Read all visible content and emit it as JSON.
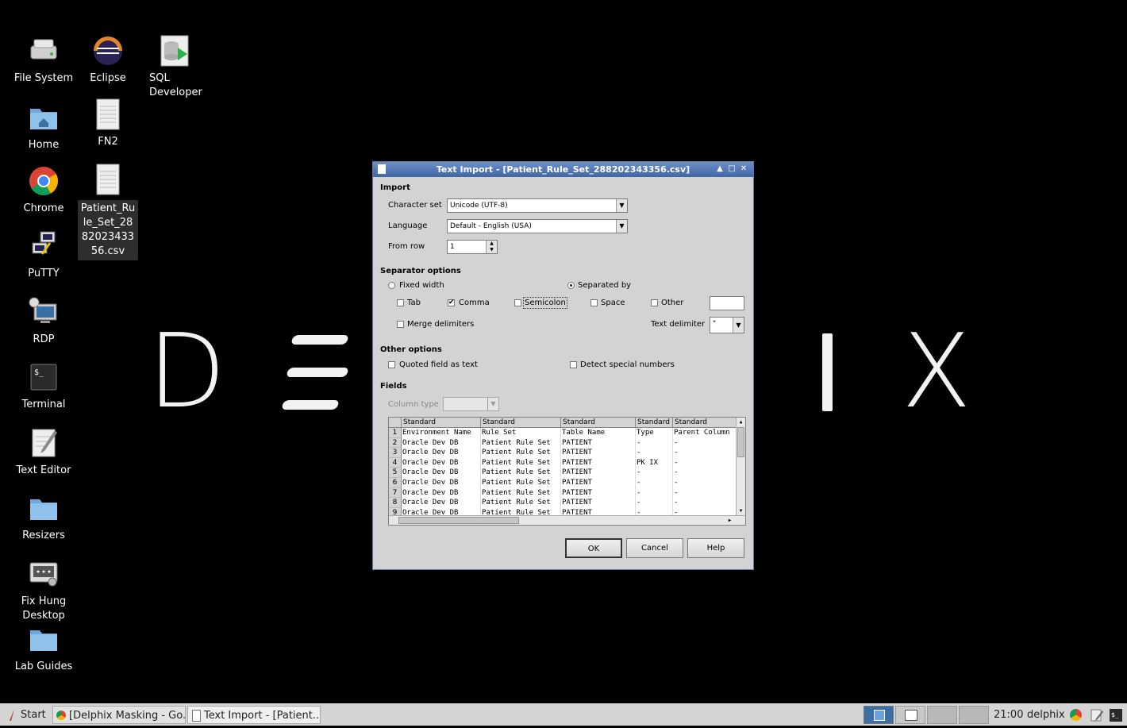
{
  "desktop": {
    "background_letters": [
      "D",
      "I",
      "X"
    ],
    "icons": [
      {
        "label": "File System",
        "icon": "drive-icon"
      },
      {
        "label": "Eclipse",
        "icon": "eclipse-icon"
      },
      {
        "label": "SQL Developer",
        "icon": "database-icon"
      },
      {
        "label": "Home",
        "icon": "home-folder-icon"
      },
      {
        "label": "FN2",
        "icon": "document-icon"
      },
      {
        "label": "Chrome",
        "icon": "chrome-icon"
      },
      {
        "label": "Patient_Rule_Set_288202343356.csv",
        "icon": "document-icon"
      },
      {
        "label": "PuTTY",
        "icon": "putty-icon"
      },
      {
        "label": "RDP",
        "icon": "rdp-icon"
      },
      {
        "label": "Terminal",
        "icon": "terminal-icon"
      },
      {
        "label": "Text Editor",
        "icon": "text-editor-icon"
      },
      {
        "label": "Resizers",
        "icon": "folder-icon"
      },
      {
        "label": "Fix Hung Desktop",
        "icon": "keyboard-icon"
      },
      {
        "label": "Lab Guides",
        "icon": "folder-icon"
      }
    ]
  },
  "dialog": {
    "title": "Text Import - [Patient_Rule_Set_288202343356.csv]",
    "import": {
      "section": "Import",
      "charset_label": "Character set",
      "charset_value": "Unicode (UTF-8)",
      "language_label": "Language",
      "language_value": "Default - English (USA)",
      "from_row_label": "From row",
      "from_row_value": "1"
    },
    "separator": {
      "section": "Separator options",
      "fixed_width": "Fixed width",
      "separated_by": "Separated by",
      "tab": "Tab",
      "comma": "Comma",
      "semicolon": "Semicolon",
      "space": "Space",
      "other": "Other",
      "merge": "Merge delimiters",
      "text_delimiter_label": "Text delimiter",
      "text_delimiter_value": "\"",
      "selected_mode": "separated_by",
      "checked": [
        "comma"
      ]
    },
    "other_options": {
      "section": "Other options",
      "quoted_field": "Quoted field as text",
      "detect_special": "Detect special numbers"
    },
    "fields": {
      "section": "Fields",
      "column_type_label": "Column type",
      "column_type_value": "",
      "headers": [
        "Standard",
        "Standard",
        "Standard",
        "Standard",
        "Standard"
      ],
      "rows": [
        [
          "1",
          "Environment Name",
          "Rule Set",
          "Table Name",
          "Type",
          "Parent Column"
        ],
        [
          "2",
          "Oracle Dev DB",
          "Patient Rule Set",
          "PATIENT",
          "-",
          "-"
        ],
        [
          "3",
          "Oracle Dev DB",
          "Patient Rule Set",
          "PATIENT",
          "-",
          "-"
        ],
        [
          "4",
          "Oracle Dev DB",
          "Patient Rule Set",
          "PATIENT",
          "PK IX",
          "-"
        ],
        [
          "5",
          "Oracle Dev DB",
          "Patient Rule Set",
          "PATIENT",
          "-",
          "-"
        ],
        [
          "6",
          "Oracle Dev DB",
          "Patient Rule Set",
          "PATIENT",
          "-",
          "-"
        ],
        [
          "7",
          "Oracle Dev DB",
          "Patient Rule Set",
          "PATIENT",
          "-",
          "-"
        ],
        [
          "8",
          "Oracle Dev DB",
          "Patient Rule Set",
          "PATIENT",
          "-",
          "-"
        ],
        [
          "9",
          "Oracle Dev DB",
          "Patient Rule Set",
          "PATIENT",
          "-",
          "-"
        ]
      ]
    },
    "buttons": {
      "ok": "OK",
      "cancel": "Cancel",
      "help": "Help"
    }
  },
  "taskbar": {
    "start": "Start",
    "tasks": [
      "[Delphix Masking - Go...",
      "Text Import - [Patient..."
    ],
    "clock": "21:00",
    "user": "delphix"
  }
}
